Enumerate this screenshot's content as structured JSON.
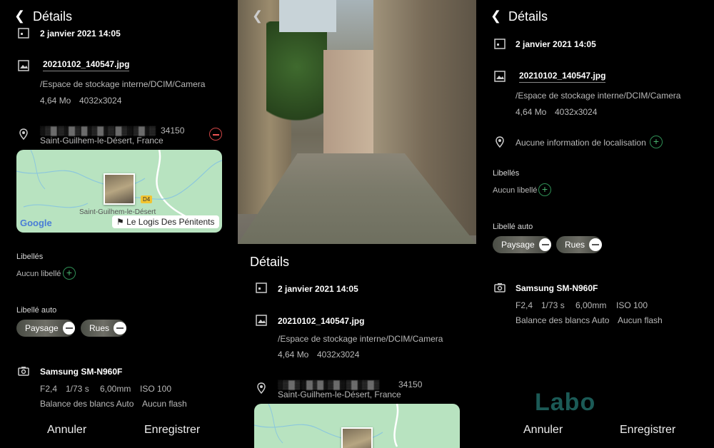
{
  "left": {
    "header": {
      "back_icon": "arrow-left-icon",
      "title": "Détails"
    },
    "date": "2 janvier 2021 14:05",
    "file": {
      "name": "20210102_140547.jpg",
      "path": "/Espace de stockage interne/DCIM/Camera",
      "size": "4,64 Mo",
      "resolution": "4032x3024"
    },
    "location": {
      "address_blurred": "░▒▓ ▒░▓▒ ▓░▒▓░▒ ▓▒░ ▒▓░▒",
      "postcode": "34150",
      "city": "Saint-Guilhem-le-Désert, France"
    },
    "map": {
      "road": "D4",
      "town": "Saint-Guilhem-le-Désert",
      "brand": "Google",
      "poi": "Le Logis Des Pénitents"
    },
    "labels": {
      "heading": "Libellés",
      "empty": "Aucun libellé"
    },
    "auto_labels": {
      "heading": "Libellé auto",
      "chips": [
        "Paysage",
        "Rues"
      ]
    },
    "camera": {
      "model": "Samsung SM-N960F",
      "aperture": "F2,4",
      "shutter": "1/73 s",
      "focal": "6,00mm",
      "iso": "ISO 100",
      "white_balance": "Balance des blancs Auto",
      "flash": "Aucun flash"
    },
    "actions": {
      "cancel": "Annuler",
      "save": "Enregistrer"
    }
  },
  "middle": {
    "title": "Détails",
    "date": "2 janvier 2021 14:05",
    "file": {
      "name": "20210102_140547.jpg",
      "path": "/Espace de stockage interne/DCIM/Camera",
      "size": "4,64 Mo",
      "resolution": "4032x3024"
    },
    "location": {
      "address_blurred": "░▒▓▒ ░▓▒▓░▒▓░ ▒▓░▒▓▒",
      "postcode": "34150",
      "city": "Saint-Guilhem-le-Désert, France"
    }
  },
  "right": {
    "header": {
      "back_icon": "arrow-left-icon",
      "title": "Détails"
    },
    "date": "2 janvier 2021 14:05",
    "file": {
      "name": "20210102_140547.jpg",
      "path": "/Espace de stockage interne/DCIM/Camera",
      "size": "4,64 Mo",
      "resolution": "4032x3024"
    },
    "location": {
      "empty": "Aucune information de localisation"
    },
    "labels": {
      "heading": "Libellés",
      "empty": "Aucun libellé"
    },
    "auto_labels": {
      "heading": "Libellé auto",
      "chips": [
        "Paysage",
        "Rues"
      ]
    },
    "camera": {
      "model": "Samsung SM-N960F",
      "aperture": "F2,4",
      "shutter": "1/73 s",
      "focal": "6,00mm",
      "iso": "ISO 100",
      "white_balance": "Balance des blancs Auto",
      "flash": "Aucun flash"
    },
    "actions": {
      "cancel": "Annuler",
      "save": "Enregistrer"
    },
    "watermark": "Labo"
  },
  "colors": {
    "accent_green": "#49b36f",
    "remove_red": "#e55555",
    "watermark": "#1b5a56"
  }
}
